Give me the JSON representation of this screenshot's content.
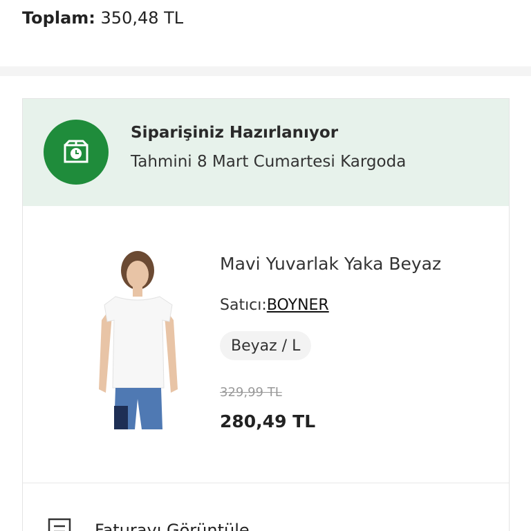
{
  "summary": {
    "total_label": "Toplam:",
    "total_value": "350,48 TL"
  },
  "status": {
    "title": "Siparişiniz Hazırlanıyor",
    "subtitle": "Tahmini 8 Mart Cumartesi Kargoda",
    "icon": "package-clock-icon",
    "accent_color": "#1f8c3b",
    "background_color": "#e7f2eb"
  },
  "product": {
    "title": "Mavi Yuvarlak Yaka Beyaz",
    "seller_label": "Satıcı:",
    "seller_name": "BOYNER",
    "variant": "Beyaz / L",
    "old_price": "329,99 TL",
    "price": "280,49 TL"
  },
  "invoice": {
    "label": "Faturayı Görüntüle",
    "icon": "document-icon"
  }
}
